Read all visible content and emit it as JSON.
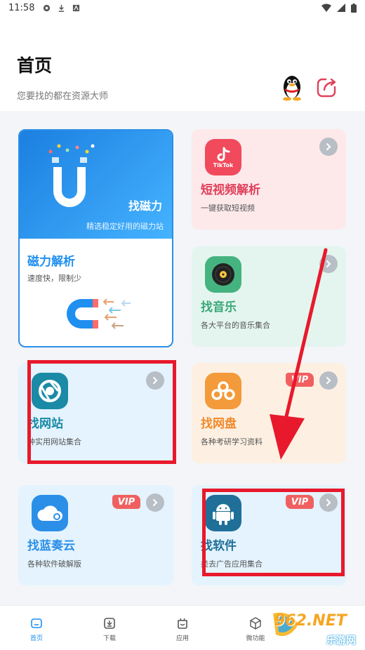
{
  "status_bar": {
    "time": "11:58"
  },
  "header": {
    "title": "首页",
    "subtitle": "您要找的都在资源大师"
  },
  "cards": {
    "magnet": {
      "top_title": "找磁力",
      "top_desc": "精选稳定好用的磁力站",
      "title": "磁力解析",
      "desc": "速度快，限制少"
    },
    "short_video": {
      "icon_text": "TikTok",
      "title": "短视频解析",
      "desc": "一键获取短视频"
    },
    "music": {
      "title": "找音乐",
      "desc": "各大平台的音乐集合"
    },
    "website": {
      "title": "找网站",
      "desc": "种实用网站集合"
    },
    "netdisk": {
      "vip": "VIP",
      "title": "找网盘",
      "desc": "各种考研学习资料"
    },
    "lanzou": {
      "vip": "VIP",
      "title": "找蓝奏云",
      "desc": "各种软件破解版"
    },
    "software": {
      "vip": "VIP",
      "title": "找软件",
      "desc": "类去广告应用集合"
    }
  },
  "bottom_nav": [
    {
      "label": "首页",
      "icon": "home-icon",
      "active": true
    },
    {
      "label": "下载",
      "icon": "download-icon",
      "active": false
    },
    {
      "label": "应用",
      "icon": "apps-icon",
      "active": false
    },
    {
      "label": "微功能",
      "icon": "cube-icon",
      "active": false
    }
  ],
  "watermark": {
    "brand": "962.NET",
    "sub": "乐游网"
  },
  "colors": {
    "accent_blue": "#1f8ff0",
    "short_video_bg": "#fde8ea",
    "music_bg": "#e4f5ef",
    "website_bg": "#e4f3fd",
    "netdisk_bg": "#fdf0e2",
    "lanzou_bg": "#e4f3fd",
    "software_bg": "#e4f3fd",
    "vip_red": "#f06060",
    "annotation_red": "#e8192c"
  }
}
